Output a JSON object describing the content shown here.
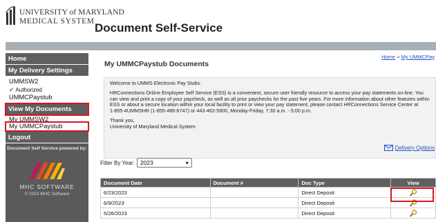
{
  "header": {
    "org_line1": "UNIVERSITY of MARYLAND",
    "org_line2": "MEDICAL SYSTEM",
    "app_title": "Document Self-Service"
  },
  "sidebar": {
    "home": "Home",
    "delivery_settings_header": "My Delivery Settings",
    "user": "UMMSW2",
    "authorized": "Authorized",
    "paystub_service": "UMMCPaystub",
    "view_documents_header": "View My Documents",
    "doc_user": "My UMMSW2",
    "doc_paystub": "My UMMCPaystub",
    "logout": "Logout",
    "powered_by": "Document Self Service powered by:",
    "vendor_name": "MHC SOFTWARE",
    "vendor_copyright": "© 2023  MHC Software"
  },
  "main": {
    "page_title": "My UMMCPaystub Documents",
    "breadcrumb_home": "Home",
    "breadcrumb_sep": " > ",
    "breadcrumb_current": "My UMMCPay",
    "welcome_line": "Welcome to UMMS Electronic Pay Stubs.",
    "info_paragraph": "HRConnections Online Employee Self Service (ESS) is a convenient, secure user friendly resource to access your pay statements on-line. You can view and print a copy of your paycheck, as well as all prior paychecks for the past five years.  For more information about other features within ESS or about a secure location within your local facility to print or view your pay statement, please contact HRConnections Service Center at",
    "contact_line": "1-855-4UMMSHR (1-855-486-6747) or 443-462-5900, Monday-Friday, 7:30 a.m. - 5:00 p.m.",
    "thanks": "Thank you,",
    "signature": "University of Maryland Medical System",
    "delivery_options": "Delivery Options",
    "filter_label": "Filter By Year:",
    "filter_value": "2023"
  },
  "table": {
    "headers": [
      "Document Date",
      "Document #",
      "Doc Type",
      "View"
    ],
    "rows": [
      {
        "date": "6/23/2023",
        "doc_number": "",
        "doc_type": "Direct Deposit"
      },
      {
        "date": "6/9/2023",
        "doc_number": "",
        "doc_type": "Direct Deposit"
      },
      {
        "date": "5/26/2023",
        "doc_number": "",
        "doc_type": "Direct Deposit"
      }
    ]
  },
  "icons": {
    "logo": "umms-logo-icon",
    "authorized": "checkmark-icon",
    "delivery": "envelope-icon",
    "view": "magnifier-icon",
    "dropdown": "chevron-down-icon"
  },
  "colors": {
    "nav_dark": "#5f5f5f",
    "highlight_red": "#d9141c",
    "link_blue": "#1f4fbf",
    "check_green": "#3a9a2e"
  }
}
